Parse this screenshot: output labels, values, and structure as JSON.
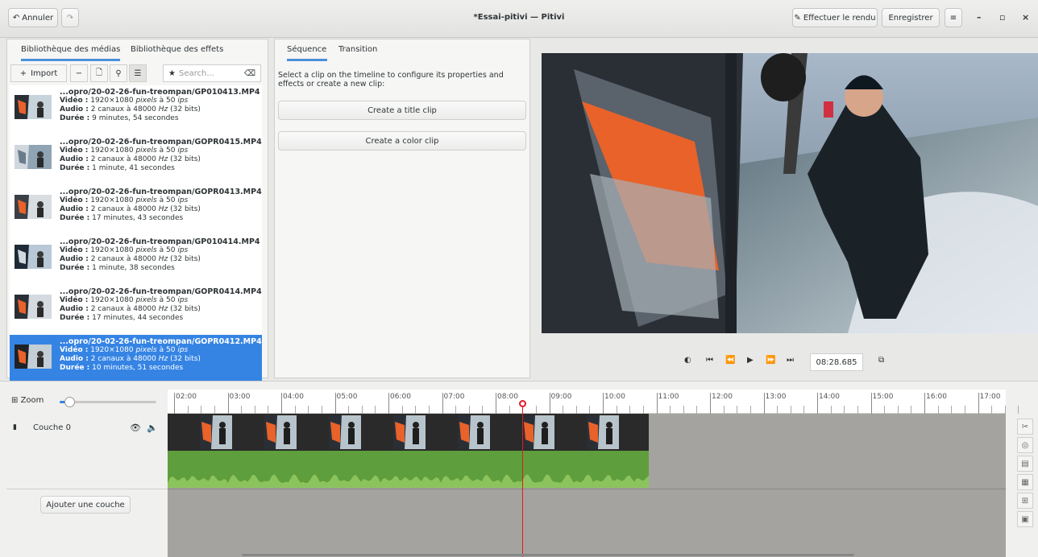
{
  "header": {
    "undo_label": "Annuler",
    "redo_icon": "redo-icon",
    "title": "*Essai-pitivi — Pitivi",
    "render_label": "Effectuer le rendu",
    "save_label": "Enregistrer"
  },
  "left_panel": {
    "tabs": [
      "Bibliothèque des médias",
      "Bibliothèque des effets"
    ],
    "import_label": "Import",
    "search_placeholder": "Search...",
    "media": [
      {
        "file": "...opro/20-02-26-fun-treompan/GP010413.MP4",
        "video_label": "Vidéo :",
        "video": "1920×1080",
        "video_pixels": "pixels",
        "video_rate": "à 50",
        "video_ips": "ips",
        "audio_label": "Audio :",
        "audio": "2 canaux à 48000",
        "audio_hz": "Hz",
        "audio_bits": "(32 bits)",
        "duration_label": "Durée :",
        "duration": "9 minutes, 54 secondes"
      },
      {
        "file": "...opro/20-02-26-fun-treompan/GOPR0415.MP4",
        "video_label": "Vidéo :",
        "video": "1920×1080",
        "video_pixels": "pixels",
        "video_rate": "à 50",
        "video_ips": "ips",
        "audio_label": "Audio :",
        "audio": "2 canaux à 48000",
        "audio_hz": "Hz",
        "audio_bits": "(32 bits)",
        "duration_label": "Durée :",
        "duration": "1 minute, 41 secondes"
      },
      {
        "file": "...opro/20-02-26-fun-treompan/GOPR0413.MP4",
        "video_label": "Vidéo :",
        "video": "1920×1080",
        "video_pixels": "pixels",
        "video_rate": "à 50",
        "video_ips": "ips",
        "audio_label": "Audio :",
        "audio": "2 canaux à 48000",
        "audio_hz": "Hz",
        "audio_bits": "(32 bits)",
        "duration_label": "Durée :",
        "duration": "17 minutes, 43 secondes"
      },
      {
        "file": "...opro/20-02-26-fun-treompan/GP010414.MP4",
        "video_label": "Vidéo :",
        "video": "1920×1080",
        "video_pixels": "pixels",
        "video_rate": "à 50",
        "video_ips": "ips",
        "audio_label": "Audio :",
        "audio": "2 canaux à 48000",
        "audio_hz": "Hz",
        "audio_bits": "(32 bits)",
        "duration_label": "Durée :",
        "duration": "1 minute, 38 secondes"
      },
      {
        "file": "...opro/20-02-26-fun-treompan/GOPR0414.MP4",
        "video_label": "Vidéo :",
        "video": "1920×1080",
        "video_pixels": "pixels",
        "video_rate": "à 50",
        "video_ips": "ips",
        "audio_label": "Audio :",
        "audio": "2 canaux à 48000",
        "audio_hz": "Hz",
        "audio_bits": "(32 bits)",
        "duration_label": "Durée :",
        "duration": "17 minutes, 44 secondes"
      },
      {
        "file": "...opro/20-02-26-fun-treompan/GOPR0412.MP4",
        "video_label": "Vidéo :",
        "video": "1920×1080",
        "video_pixels": "pixels",
        "video_rate": "à 50",
        "video_ips": "ips",
        "audio_label": "Audio :",
        "audio": "2 canaux à 48000",
        "audio_hz": "Hz",
        "audio_bits": "(32 bits)",
        "duration_label": "Durée :",
        "duration": "10 minutes, 51 secondes"
      }
    ]
  },
  "middle_panel": {
    "tabs": [
      "Séquence",
      "Transition"
    ],
    "hint": "Select a clip on the timeline to configure its properties and effects or create a new clip:",
    "title_clip_label": "Create a title clip",
    "color_clip_label": "Create a color clip"
  },
  "viewer": {
    "timecode": "08:28.685"
  },
  "timeline": {
    "zoom_label": "Zoom",
    "zoom_level": 0.1,
    "ticks": [
      "02:00",
      "03:00",
      "04:00",
      "05:00",
      "06:00",
      "07:00",
      "08:00",
      "09:00",
      "10:00",
      "11:00",
      "12:00",
      "13:00",
      "14:00",
      "15:00",
      "16:00",
      "17:00"
    ],
    "layer_label": "Couche 0",
    "add_layer_label": "Ajouter une couche"
  },
  "colors": {
    "accent": "#3584e4",
    "playhead": "#e01b24",
    "audio": "#5e9e3c",
    "timeline_bg": "#9a9996"
  }
}
